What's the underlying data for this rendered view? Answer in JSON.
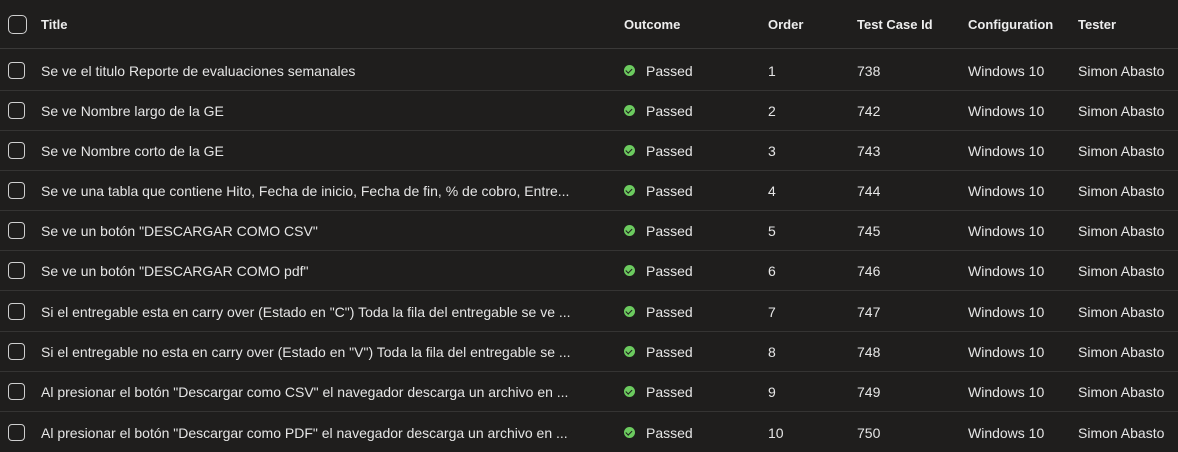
{
  "columns": {
    "title": "Title",
    "outcome": "Outcome",
    "order": "Order",
    "test_case_id": "Test Case Id",
    "configuration": "Configuration",
    "tester": "Tester"
  },
  "colors": {
    "passed": "#6ccb5f",
    "background": "#1f1e1d"
  },
  "rows": [
    {
      "title": "Se ve el titulo Reporte de evaluaciones semanales",
      "outcome": "Passed",
      "order": "1",
      "id": "738",
      "config": "Windows 10",
      "tester": "Simon Abasto"
    },
    {
      "title": "Se ve Nombre largo de la GE",
      "outcome": "Passed",
      "order": "2",
      "id": "742",
      "config": "Windows 10",
      "tester": "Simon Abasto"
    },
    {
      "title": "Se ve Nombre corto de la GE",
      "outcome": "Passed",
      "order": "3",
      "id": "743",
      "config": "Windows 10",
      "tester": "Simon Abasto"
    },
    {
      "title": "Se ve una tabla que contiene Hito, Fecha de inicio, Fecha de fin, % de cobro, Entre...",
      "outcome": "Passed",
      "order": "4",
      "id": "744",
      "config": "Windows 10",
      "tester": "Simon Abasto"
    },
    {
      "title": "Se ve un botón \"DESCARGAR COMO CSV\"",
      "outcome": "Passed",
      "order": "5",
      "id": "745",
      "config": "Windows 10",
      "tester": "Simon Abasto"
    },
    {
      "title": "Se ve un botón \"DESCARGAR COMO pdf\"",
      "outcome": "Passed",
      "order": "6",
      "id": "746",
      "config": "Windows 10",
      "tester": "Simon Abasto"
    },
    {
      "title": "Si el entregable esta en carry over (Estado en \"C\") Toda la fila del entregable se ve ...",
      "outcome": "Passed",
      "order": "7",
      "id": "747",
      "config": "Windows 10",
      "tester": "Simon Abasto"
    },
    {
      "title": "Si el entregable no esta en carry over (Estado en \"V\") Toda la fila del entregable se ...",
      "outcome": "Passed",
      "order": "8",
      "id": "748",
      "config": "Windows 10",
      "tester": "Simon Abasto"
    },
    {
      "title": "Al presionar el botón \"Descargar como CSV\" el navegador descarga un archivo en ...",
      "outcome": "Passed",
      "order": "9",
      "id": "749",
      "config": "Windows 10",
      "tester": "Simon Abasto"
    },
    {
      "title": "Al presionar el botón \"Descargar como PDF\" el navegador descarga un archivo en ...",
      "outcome": "Passed",
      "order": "10",
      "id": "750",
      "config": "Windows 10",
      "tester": "Simon Abasto"
    }
  ]
}
